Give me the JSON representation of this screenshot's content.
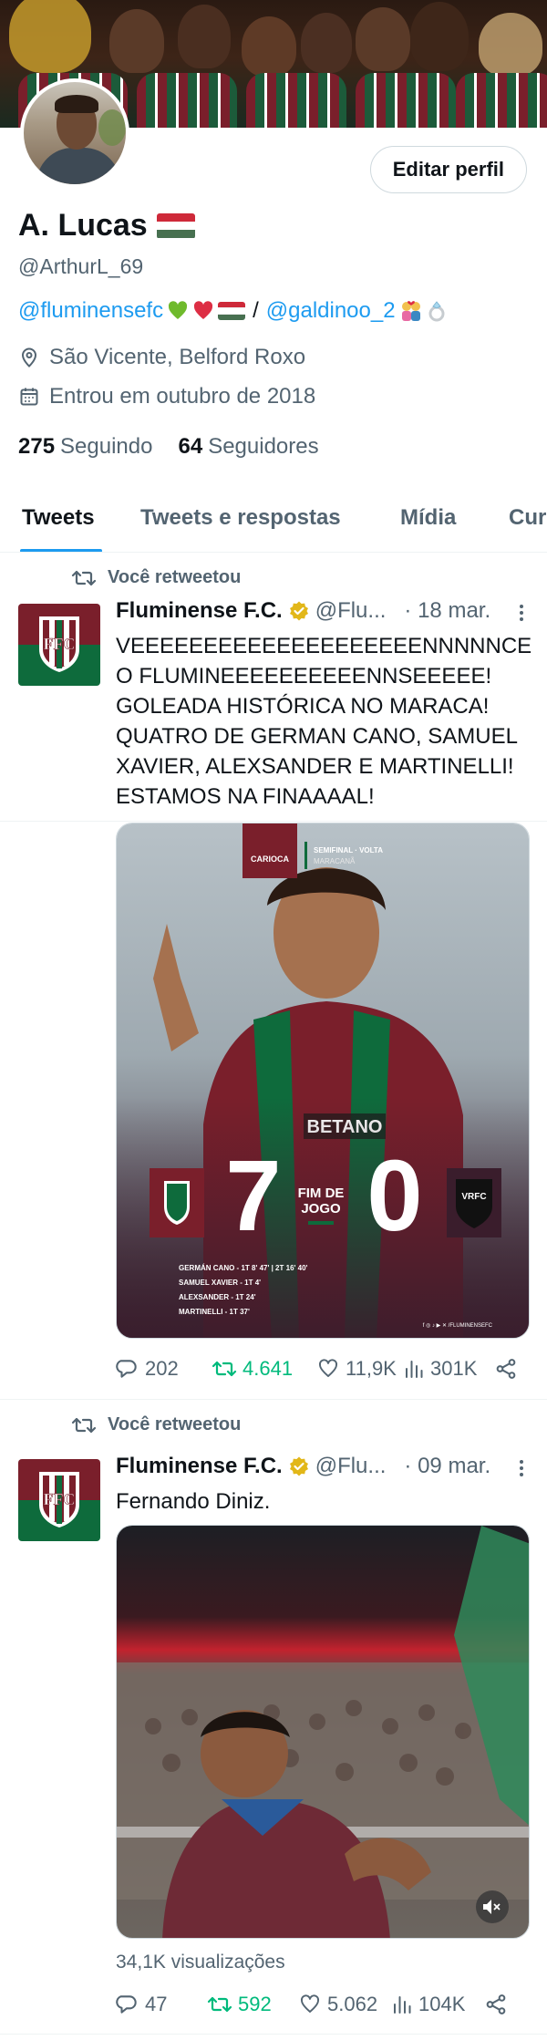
{
  "profile": {
    "name": "A. Lucas",
    "handle": "@ArthurL_69",
    "bio_link1": "@fluminensefc",
    "bio_separator": "/",
    "bio_link2": "@galdinoo_2",
    "location": "São Vicente, Belford Roxo",
    "joined": "Entrou em outubro de 2018",
    "following_count": "275",
    "following_label": "Seguindo",
    "followers_count": "64",
    "followers_label": "Seguidores",
    "edit_button": "Editar perfil"
  },
  "tabs": [
    {
      "label": "Tweets",
      "active": true
    },
    {
      "label": "Tweets e respostas",
      "active": false
    },
    {
      "label": "Mídia",
      "active": false
    },
    {
      "label": "Cur",
      "active": false
    }
  ],
  "tweets": [
    {
      "retweet_label": "Você retweetou",
      "author": "Fluminense F.C.",
      "handle": "@Flu...",
      "date": "· 18 mar.",
      "text": "VEEEEEEEEEEEEEEEEEEEENNNNNCE O FLUMINEEEEEEEEEENNSEEEEE! GOLEADA HISTÓRICA NO MARACA! QUATRO DE GERMAN CANO, SAMUEL XAVIER, ALEXSANDER E MARTINELLI! ESTAMOS NA FINAAAAL!",
      "media": {
        "badge": "CARIOCA",
        "stage": "SEMIFINAL · VOLTA",
        "venue": "MARACANÃ",
        "score_home": "7",
        "score_away": "0",
        "status": "FIM DE JOGO",
        "away_team": "VRFC",
        "sponsor": "BETANO",
        "scorers": [
          "GERMÁN CANO - 1T 8' 47' | 2T 16' 40'",
          "SAMUEL XAVIER - 1T 4'",
          "ALEXSANDER - 1T 24'",
          "MARTINELLI - 1T 37'"
        ],
        "social": "f ◎ ♪ ▶ ✕ /FLUMINENSEFC"
      },
      "replies": "202",
      "retweets": "4.641",
      "likes": "11,9K",
      "views": "301K"
    },
    {
      "retweet_label": "Você retweetou",
      "author": "Fluminense F.C.",
      "handle": "@Flu...",
      "date": "· 09 mar.",
      "text": "Fernando Diniz.",
      "views_label": "34,1K visualizações",
      "replies": "47",
      "retweets": "592",
      "likes": "5.062",
      "views": "104K"
    }
  ],
  "colors": {
    "accent": "#1d9bf0",
    "retweet_green": "#00ba7c",
    "muted": "#536471",
    "club_grena": "#7a1f2b",
    "club_green": "#0e6b3c"
  },
  "icons": [
    "location-icon",
    "calendar-icon",
    "retweet-icon",
    "verified-icon",
    "more-icon",
    "reply-icon",
    "like-icon",
    "views-icon",
    "share-icon",
    "mute-icon"
  ]
}
